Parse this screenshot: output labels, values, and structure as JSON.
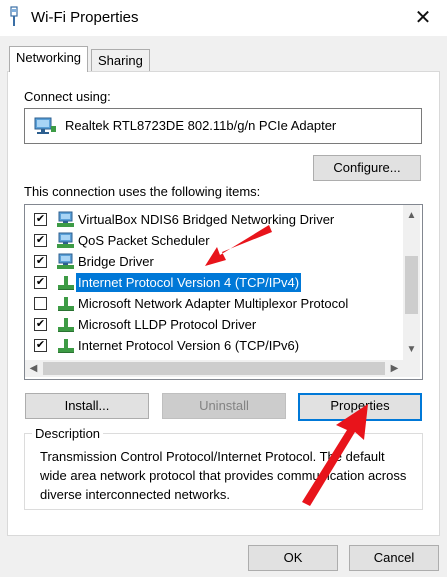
{
  "window": {
    "title": "Wi-Fi Properties",
    "close_glyph": "✕",
    "icon": "network-adapter-icon"
  },
  "tabs": [
    {
      "label": "Networking",
      "active": true
    },
    {
      "label": "Sharing",
      "active": false
    }
  ],
  "connect_using": {
    "label": "Connect using:",
    "adapter": "Realtek RTL8723DE 802.11b/g/n PCIe Adapter",
    "configure_button": "Configure..."
  },
  "items_section": {
    "label": "This connection uses the following items:",
    "items": [
      {
        "label": "VirtualBox NDIS6 Bridged Networking Driver",
        "checked": true,
        "icon": "network-client-icon",
        "selected": false
      },
      {
        "label": "QoS Packet Scheduler",
        "checked": true,
        "icon": "network-client-icon",
        "selected": false
      },
      {
        "label": "Bridge Driver",
        "checked": true,
        "icon": "network-client-icon",
        "selected": false
      },
      {
        "label": "Internet Protocol Version 4 (TCP/IPv4)",
        "checked": true,
        "icon": "protocol-icon",
        "selected": true
      },
      {
        "label": "Microsoft Network Adapter Multiplexor Protocol",
        "checked": false,
        "icon": "protocol-icon",
        "selected": false
      },
      {
        "label": "Microsoft LLDP Protocol Driver",
        "checked": true,
        "icon": "protocol-icon",
        "selected": false
      },
      {
        "label": "Internet Protocol Version 6 (TCP/IPv6)",
        "checked": true,
        "icon": "protocol-icon",
        "selected": false
      }
    ],
    "scroll_up": "▲",
    "scroll_down": "▼",
    "scroll_left": "◀",
    "scroll_right": "▶"
  },
  "actions": {
    "install": "Install...",
    "uninstall": "Uninstall",
    "properties": "Properties"
  },
  "description": {
    "title": "Description",
    "text": "Transmission Control Protocol/Internet Protocol. The default wide area network protocol that provides communication across diverse interconnected networks."
  },
  "footer": {
    "ok": "OK",
    "cancel": "Cancel"
  },
  "colors": {
    "selection": "#0078d7",
    "annotation_arrow": "#e8141b",
    "focus_border": "#0078d7"
  }
}
